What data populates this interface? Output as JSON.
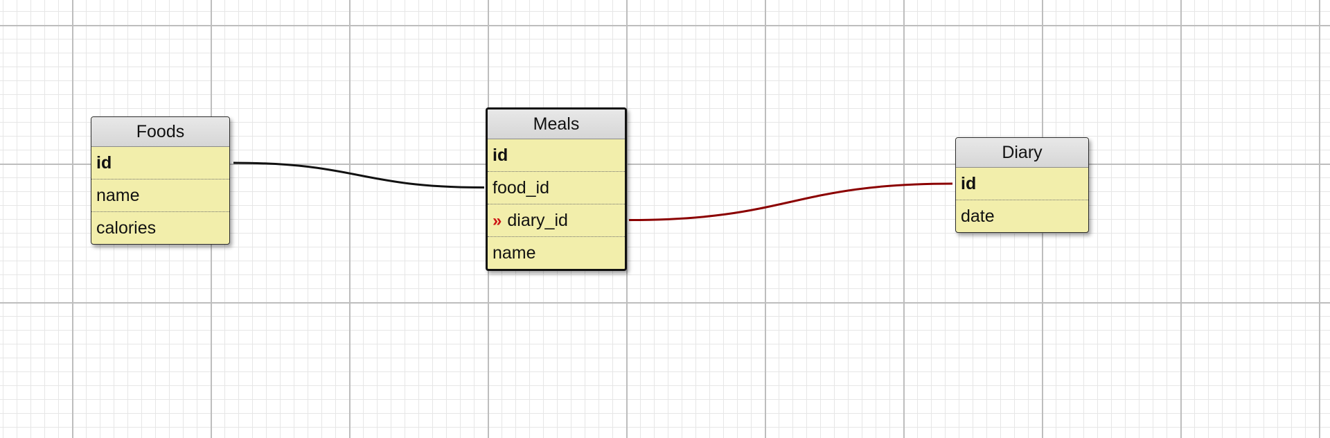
{
  "tables": [
    {
      "id": "foods",
      "title": "Foods",
      "fields": [
        {
          "label": "id",
          "pk": true
        },
        {
          "label": "name"
        },
        {
          "label": "calories"
        }
      ]
    },
    {
      "id": "meals",
      "title": "Meals",
      "selected": true,
      "fields": [
        {
          "label": "id",
          "pk": true
        },
        {
          "label": "food_id"
        },
        {
          "label": "diary_id",
          "fk_icon": "»"
        },
        {
          "label": "name"
        }
      ]
    },
    {
      "id": "diary",
      "title": "Diary",
      "fields": [
        {
          "label": "id",
          "pk": true
        },
        {
          "label": "date"
        }
      ]
    }
  ],
  "relations": [
    {
      "from": "foods.id",
      "to": "meals.food_id",
      "color": "#111111"
    },
    {
      "from": "meals.diary_id",
      "to": "diary.id",
      "color": "#8b0000"
    }
  ],
  "colors": {
    "table_body": "#f2eeab",
    "table_header": "#d9d9d9",
    "grid_major": "#bdbdbd",
    "grid_minor": "#e6e6e6",
    "fk_icon": "#cc1414"
  }
}
